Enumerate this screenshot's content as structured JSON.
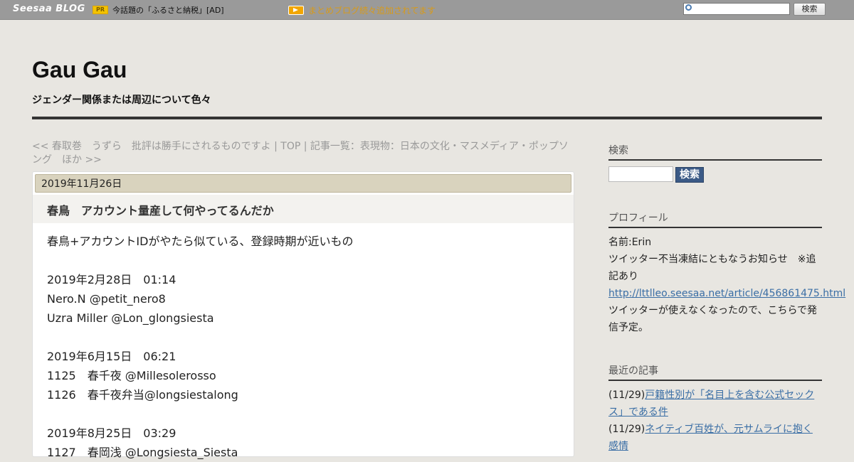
{
  "topbar": {
    "logo": "Seesaa BLOG",
    "pr_badge": "PR",
    "pr_text": "今話題の「ふるさと納税」[AD]",
    "notice": "まとめブログ続々追加されてます",
    "search_button": "検索",
    "icons": [
      "arrow-right-icon",
      "search-icon"
    ]
  },
  "header": {
    "title": "Gau Gau",
    "subtitle": "ジェンダー関係または周辺について色々"
  },
  "nav": {
    "prev": "<< 春取巻　うずら　批評は勝手にされるものですよ",
    "sep1": " | ",
    "top": "TOP",
    "sep2": " | ",
    "next": "記事一覧：表現物：日本の文化・マスメディア・ポップソング　ほか >>"
  },
  "article": {
    "date": "2019年11月26日",
    "title": "春鳥　アカウント量産して何やってるんだか",
    "lines": [
      "春鳥+アカウントIDがやたら似ている、登録時期が近いもの",
      "",
      "2019年2月28日　01:14",
      "Nero.N @petit_nero8",
      "Uzra Miller @Lon_glongsiesta",
      "",
      "2019年6月15日　06:21",
      "1125　春千夜 @Millesolerosso",
      "1126　春千夜弁当@longsiestalong",
      "",
      "2019年8月25日　03:29",
      "1127　春岡浅 @Longsiesta_Siesta"
    ]
  },
  "sidebar": {
    "search_heading": "検索",
    "search_button": "検索",
    "profile_heading": "プロフィール",
    "profile_name": "名前:Erin",
    "profile_note": "ツイッター不当凍結にともなうお知らせ　※追記あり",
    "profile_link": "http://lttlleo.seesaa.net/article/456861475.html",
    "profile_text": "ツイッターが使えなくなったので、こちらで発信予定。",
    "recent_heading": "最近の記事",
    "recent_items": [
      {
        "date": "(11/29)",
        "title": "戸籍性別が「名目上を含む公式セックス」である件"
      },
      {
        "date": "(11/29)",
        "title": "ネイティブ百姓が、元サムライに抱く感情"
      }
    ]
  },
  "colors": {
    "background": "#e8e6e1",
    "topbar": "#9a9a9a",
    "link": "#3a6ea5",
    "search_button": "#3b5a86",
    "date_bar": "#d9d3be",
    "notice": "#d79a1a"
  }
}
